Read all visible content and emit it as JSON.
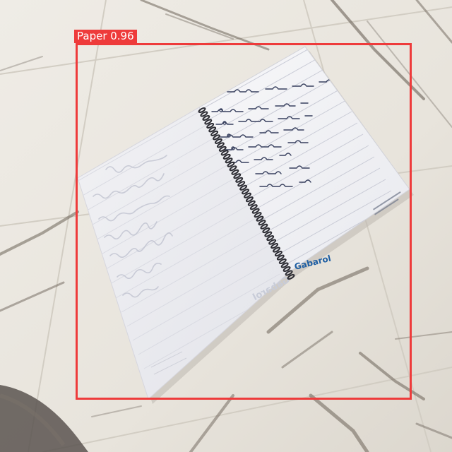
{
  "detection": {
    "label": "Paper 0.96",
    "color": "#ee3b3b"
  },
  "notebook": {
    "brand": "Gabarol",
    "brand_mirror": "Gabarol",
    "brand_color": "#1f5fa3",
    "paper_color": "#f3f3f6",
    "line_color": "#c9cbd6",
    "ink_color": "#38405e"
  },
  "floor": {
    "tile_color": "#ece8e0",
    "vein_color": "#6b6258"
  }
}
